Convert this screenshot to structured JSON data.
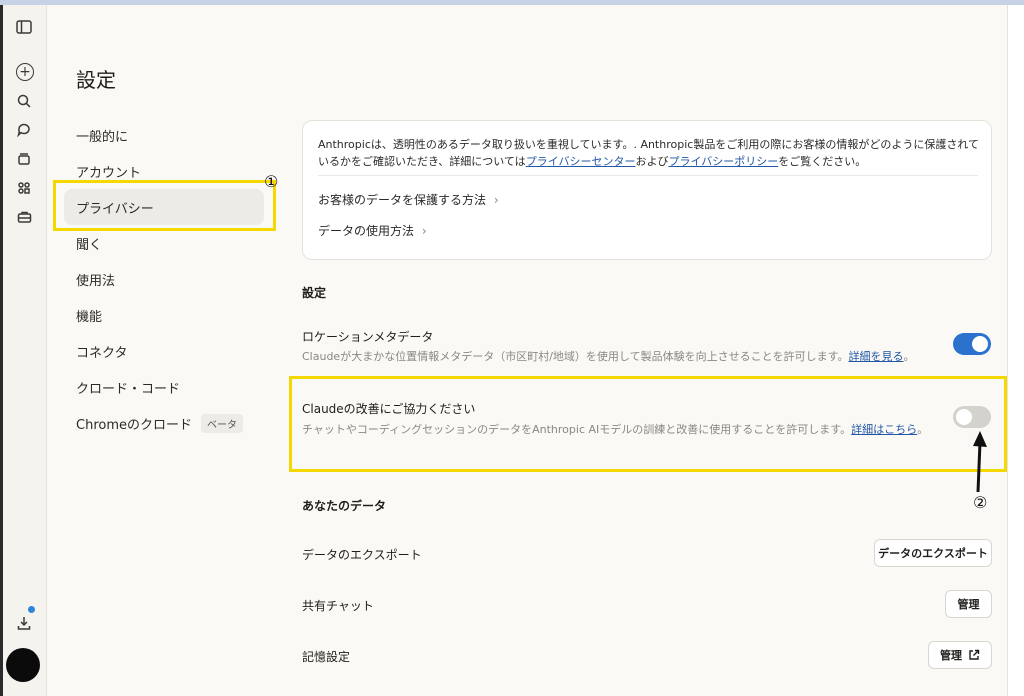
{
  "page_title": "設定",
  "nav": {
    "items": [
      "一般的に",
      "アカウント",
      "プライバシー",
      "聞く",
      "使用法",
      "機能",
      "コネクタ",
      "クロード・コード",
      "Chromeのクロード"
    ],
    "beta_badge": "ベータ",
    "active": "プライバシー"
  },
  "annotations": {
    "one": "①",
    "two": "②"
  },
  "info_card": {
    "text_before": "Anthropicは、透明性のあるデータ取り扱いを重視しています。. Anthropic製品をご利用の際にお客様の情報がどのように保護されているかをご確認いただき、詳細については",
    "link1": "プライバシーセンター",
    "text_mid": "および",
    "link2": "プライバシーポリシー",
    "text_after": "をご覧ください。",
    "protect_link": "お客様のデータを保護する方法",
    "usage_link": "データの使用方法"
  },
  "settings_section": {
    "title": "設定",
    "location": {
      "title": "ロケーションメタデータ",
      "desc": "Claudeが大まかな位置情報メタデータ（市区町村/地域）を使用して製品体験を向上させることを許可します。",
      "link": "詳細を見る",
      "suffix": "。",
      "enabled": true
    },
    "improve": {
      "title": "Claudeの改善にご協力ください",
      "desc": "チャットやコーディングセッションのデータをAnthropic AIモデルの訓練と改善に使用することを許可します。",
      "link": "詳細はこちら",
      "suffix": "。",
      "enabled": false
    }
  },
  "your_data": {
    "title": "あなたのデータ",
    "export_label": "データのエクスポート",
    "export_button": "データのエクスポート",
    "shared_label": "共有チャット",
    "shared_button": "管理",
    "memory_label": "記憶設定",
    "memory_button": "管理"
  },
  "colors": {
    "accent": "#2b72cf",
    "highlight": "#f4d800",
    "link": "#2257a6"
  }
}
